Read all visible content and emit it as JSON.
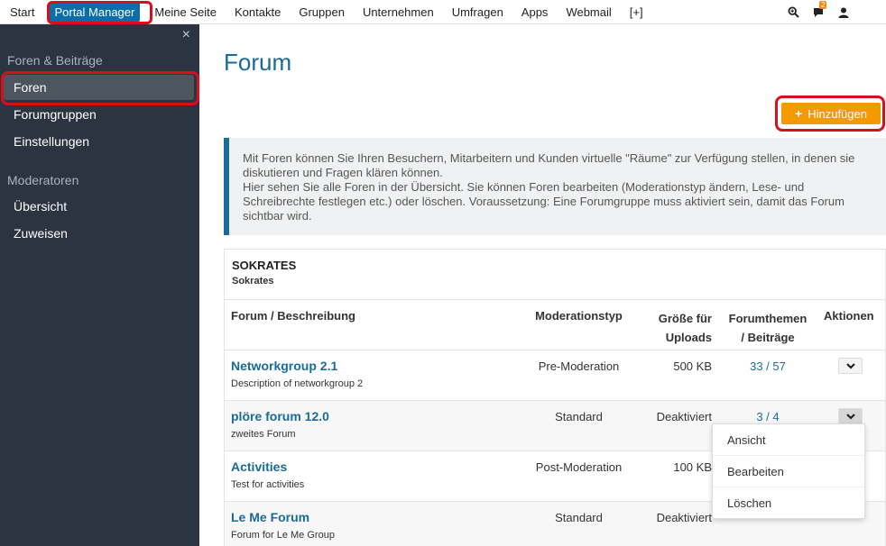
{
  "topnav": {
    "items": [
      "Start",
      "Portal Manager",
      "Meine Seite",
      "Kontakte",
      "Gruppen",
      "Unternehmen",
      "Umfragen",
      "Apps",
      "Webmail",
      "[+]"
    ],
    "notification_count": "2",
    "icons": [
      "search-icon",
      "chat-icon",
      "user-icon"
    ]
  },
  "sidebar": {
    "close": "×",
    "section1": "Foren & Beiträge",
    "items1": [
      "Foren",
      "Forumgruppen",
      "Einstellungen"
    ],
    "section2": "Moderatoren",
    "items2": [
      "Übersicht",
      "Zuweisen"
    ]
  },
  "main": {
    "title": "Forum",
    "add_button": "Hinzufügen",
    "info_text": "Mit Foren können Sie Ihren Besuchern, Mitarbeitern und Kunden virtuelle \"Räume\" zur Verfügung stellen, in denen sie diskutieren und Fragen klären können.",
    "info_text2": "Hier sehen Sie alle Foren in der Übersicht. Sie können Foren bearbeiten (Moderationstyp ändern, Lese- und Schreibrechte festlegen etc.) oder löschen. Voraussetzung: Eine Forumgruppe muss aktiviert sein, damit das Forum sichtbar wird."
  },
  "table": {
    "group_title": "SOKRATES",
    "group_subtitle": "Sokrates",
    "headers": {
      "forum": "Forum / Beschreibung",
      "moderation": "Moderationstyp",
      "size_line1": "Größe für",
      "size_line2": "Uploads",
      "topics_line1": "Forumthemen",
      "topics_line2": "/ Beiträge",
      "actions": "Aktionen"
    },
    "rows": [
      {
        "name": "Networkgroup 2.1",
        "desc": "Description of networkgroup 2",
        "moderation": "Pre-Moderation",
        "size": "500 KB",
        "topics": "33 / 57"
      },
      {
        "name": "plöre forum 12.0",
        "desc": "zweites Forum",
        "moderation": "Standard",
        "size": "Deaktiviert",
        "topics": "3 / 4"
      },
      {
        "name": "Activities",
        "desc": "Test for activities",
        "moderation": "Post-Moderation",
        "size": "100 KB",
        "topics": ""
      },
      {
        "name": "Le Me Forum",
        "desc": "Forum for Le Me Group",
        "moderation": "Standard",
        "size": "Deaktiviert",
        "topics": ""
      }
    ]
  },
  "dropdown": {
    "items": [
      "Ansicht",
      "Bearbeiten",
      "Löschen"
    ]
  },
  "colors": {
    "accent": "#1a6b99",
    "nav_active": "#0a6ea8",
    "add_button": "#f29a00",
    "sidebar_bg": "#2b3440",
    "highlight": "#d8101d"
  }
}
